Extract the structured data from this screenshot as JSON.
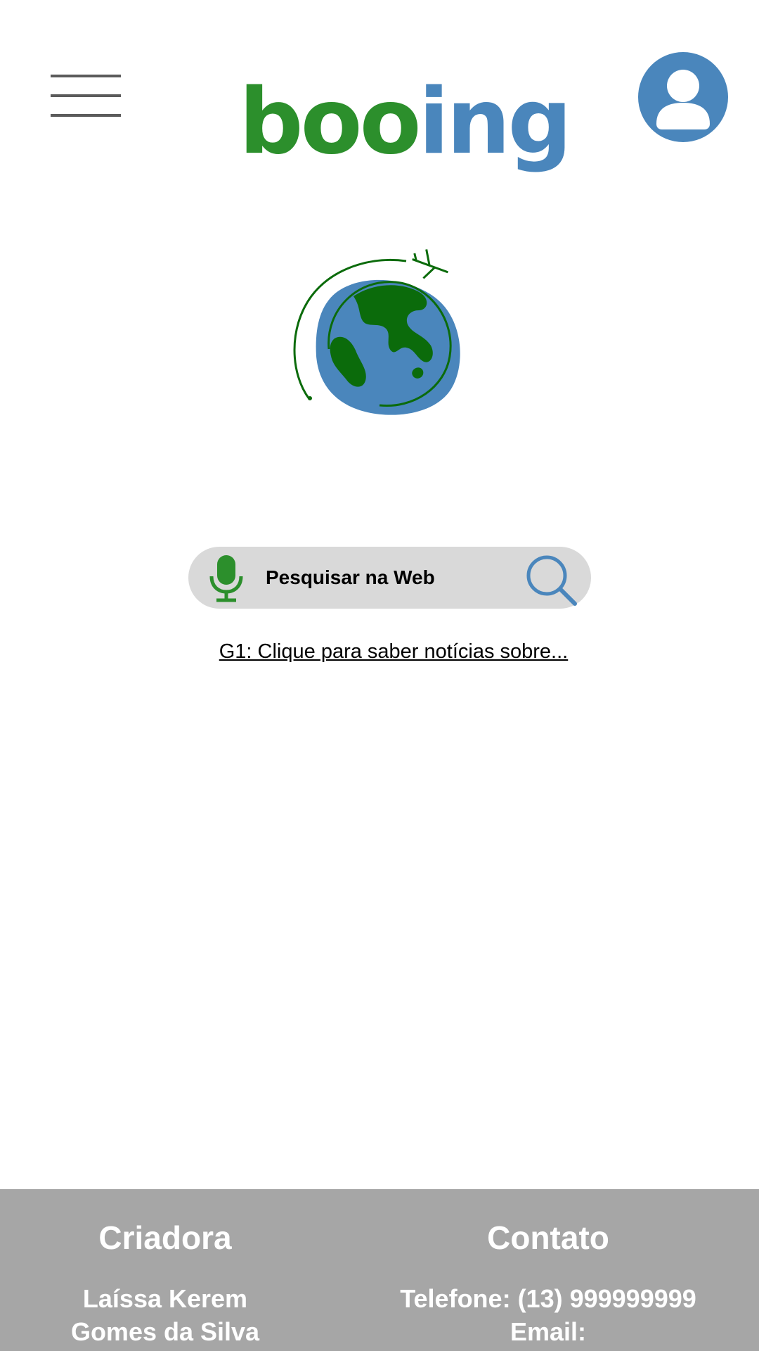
{
  "header": {
    "logo": {
      "part1": "boo",
      "part2": "ing"
    },
    "menu_icon": "hamburger-menu-icon",
    "profile_icon": "user-icon"
  },
  "hero": {
    "image": "globe-airplane-icon"
  },
  "search": {
    "placeholder": "Pesquisar na Web",
    "mic_icon": "microphone-icon",
    "search_icon": "search-icon"
  },
  "news": {
    "link_text": "G1: Clique para saber notícias sobre..."
  },
  "footer": {
    "creator": {
      "heading": "Criadora",
      "name_line1": "Laíssa Kerem",
      "name_line2": "Gomes da Silva"
    },
    "contact": {
      "heading": "Contato",
      "phone": "Telefone: (13) 999999999",
      "email_label": "Email:"
    }
  },
  "colors": {
    "green": "#2c8f2c",
    "blue": "#4a86bc",
    "dark_green": "#0b6b0b",
    "search_bg": "#d9d9d9",
    "footer_bg": "#a6a6a6",
    "menu_gray": "#5b5b5b"
  }
}
